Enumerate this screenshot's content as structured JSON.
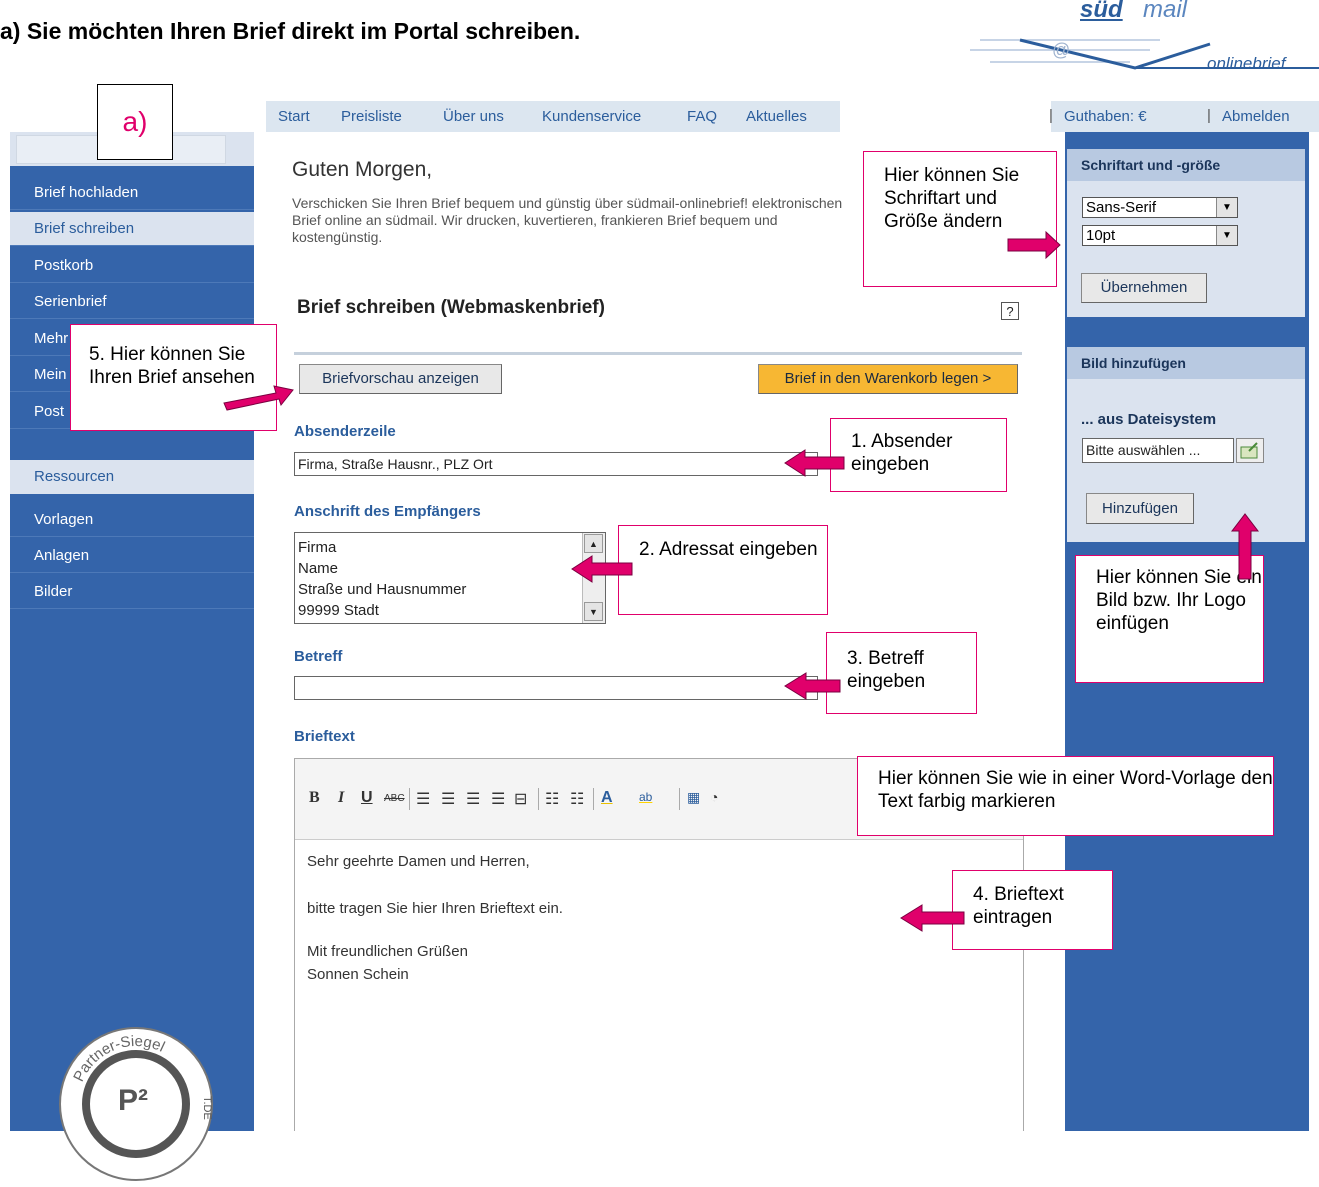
{
  "heading": "a) Sie möchten Ihren Brief direkt im Portal schreiben.",
  "logo": {
    "brand_bold": "süd",
    "brand_light": "mail",
    "subline": "onlinebrief",
    "at_symbol": "@"
  },
  "marker_label": "a)",
  "topnav": {
    "items": [
      "Start",
      "Preisliste",
      "Über uns",
      "Kundenservice",
      "FAQ",
      "Aktuelles"
    ],
    "balance": "Guthaben: €",
    "logout": "Abmelden",
    "separator": "|"
  },
  "sidebar": {
    "items": [
      "Brief hochladen",
      "Brief schreiben",
      "Postkorb",
      "Serienbrief",
      "Mehr",
      "Mein",
      "Post"
    ],
    "resources_header": "Ressourcen",
    "resource_items": [
      "Vorlagen",
      "Anlagen",
      "Bilder"
    ],
    "seal_text": "Partner-Siegel",
    "seal_logo": "P²",
    "seal_side": "T.DE"
  },
  "main": {
    "greeting": "Guten Morgen,",
    "intro": "Verschicken Sie Ihren Brief bequem und günstig über südmail-onlinebrief! elektronischen Brief online an südmail. Wir drucken, kuvertieren, frankieren Brief bequem und kostengünstig.",
    "section_title": "Brief schreiben (Webmaskenbrief)",
    "help_icon": "?",
    "preview_button": "Briefvorschau anzeigen",
    "cart_button": "Brief in den Warenkorb legen >",
    "sender_label": "Absenderzeile",
    "sender_value": "Firma, Straße Hausnr., PLZ Ort",
    "recipient_label": "Anschrift des Empfängers",
    "recipient_lines": [
      "Firma",
      "Name",
      "Straße und Hausnummer",
      "99999 Stadt"
    ],
    "subject_label": "Betreff",
    "subject_value": "",
    "body_label": "Brieftext",
    "body_lines": [
      "Sehr geehrte Damen und Herren,",
      "bitte tragen Sie hier Ihren Brieftext ein.",
      "Mit freundlichen Grüßen",
      "Sonnen Schein"
    ]
  },
  "toolbar": {
    "bold": "B",
    "italic": "I",
    "underline": "U",
    "strike": "ABC",
    "font_color": "A",
    "highlight": "ab"
  },
  "rightbar": {
    "font_panel_title": "Schriftart und -größe",
    "font_family": "Sans-Serif",
    "font_size": "10pt",
    "apply_button": "Übernehmen",
    "image_panel_title": "Bild hinzufügen",
    "from_filesystem": "... aus Dateisystem",
    "file_placeholder": "Bitte auswählen ...",
    "add_button": "Hinzufügen"
  },
  "callouts": {
    "font": "Hier können Sie Schriftart und Größe ändern",
    "preview": "5. Hier können Sie Ihren Brief ansehen",
    "sender": "1. Absender eingeben",
    "recipient": "2. Adressat eingeben",
    "subject": "3. Betreff eingeben",
    "image": "Hier können Sie ein Bild bzw. Ihr Logo einfügen",
    "toolbar": "Hier können Sie wie in einer Word-Vorlage den Text farbig markieren",
    "body": "4. Brieftext eintragen"
  },
  "colors": {
    "accent": "#e0006b",
    "nav_blue": "#3464aa",
    "link_blue": "#2b5d9c",
    "cart_orange": "#f7b733"
  }
}
